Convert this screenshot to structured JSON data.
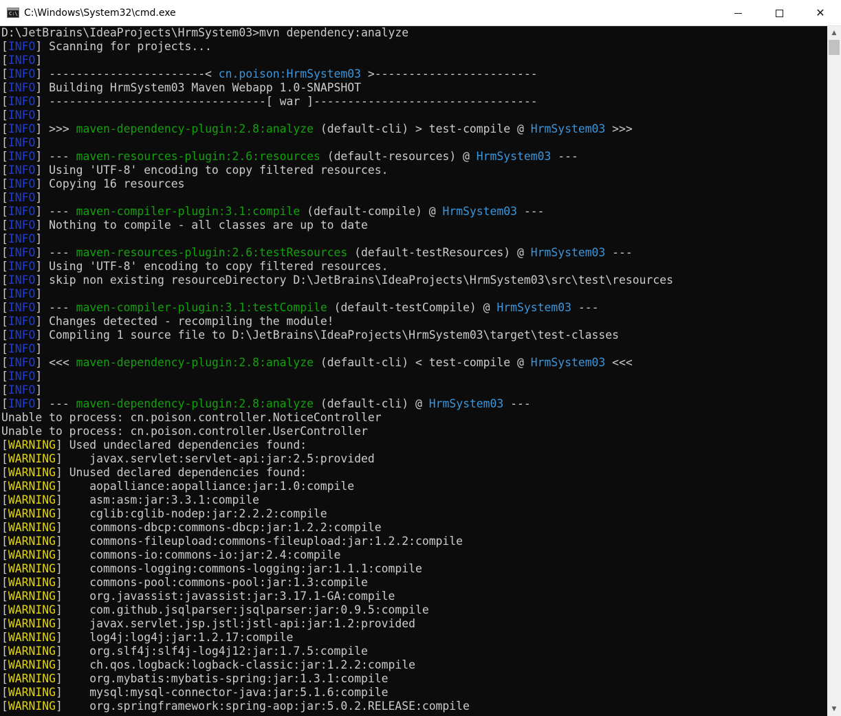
{
  "window": {
    "title": "C:\\Windows\\System32\\cmd.exe",
    "icon_text": "C:\\",
    "minimize_glyph": "",
    "maximize_glyph": "",
    "close_glyph": "✕"
  },
  "colors": {
    "info_tag": "#1f3bd8",
    "warning_tag": "#e5d500",
    "plugin": "#13a10e",
    "project": "#3a96dd",
    "text": "#cccccc",
    "background": "#0c0c0c"
  },
  "console": {
    "lines": [
      [
        {
          "t": "D:\\JetBrains\\IdeaProjects\\HrmSystem03>mvn dependency:analyze",
          "c": "text"
        }
      ],
      [
        {
          "t": "[",
          "c": "text"
        },
        {
          "t": "INFO",
          "c": "info"
        },
        {
          "t": "] Scanning for projects...",
          "c": "text"
        }
      ],
      [
        {
          "t": "[",
          "c": "text"
        },
        {
          "t": "INFO",
          "c": "info"
        },
        {
          "t": "]",
          "c": "text"
        }
      ],
      [
        {
          "t": "[",
          "c": "text"
        },
        {
          "t": "INFO",
          "c": "info"
        },
        {
          "t": "] -----------------------< ",
          "c": "text"
        },
        {
          "t": "cn.poison:HrmSystem03",
          "c": "cyan"
        },
        {
          "t": " >------------------------",
          "c": "text"
        }
      ],
      [
        {
          "t": "[",
          "c": "text"
        },
        {
          "t": "INFO",
          "c": "info"
        },
        {
          "t": "] Building HrmSystem03 Maven Webapp 1.0-SNAPSHOT",
          "c": "text"
        }
      ],
      [
        {
          "t": "[",
          "c": "text"
        },
        {
          "t": "INFO",
          "c": "info"
        },
        {
          "t": "] --------------------------------[ war ]---------------------------------",
          "c": "text"
        }
      ],
      [
        {
          "t": "[",
          "c": "text"
        },
        {
          "t": "INFO",
          "c": "info"
        },
        {
          "t": "]",
          "c": "text"
        }
      ],
      [
        {
          "t": "[",
          "c": "text"
        },
        {
          "t": "INFO",
          "c": "info"
        },
        {
          "t": "] >>> ",
          "c": "text"
        },
        {
          "t": "maven-dependency-plugin:2.8:analyze",
          "c": "green"
        },
        {
          "t": " (default-cli) > test-compile @ ",
          "c": "text"
        },
        {
          "t": "HrmSystem03",
          "c": "cyan"
        },
        {
          "t": " >>>",
          "c": "text"
        }
      ],
      [
        {
          "t": "[",
          "c": "text"
        },
        {
          "t": "INFO",
          "c": "info"
        },
        {
          "t": "]",
          "c": "text"
        }
      ],
      [
        {
          "t": "[",
          "c": "text"
        },
        {
          "t": "INFO",
          "c": "info"
        },
        {
          "t": "] --- ",
          "c": "text"
        },
        {
          "t": "maven-resources-plugin:2.6:resources",
          "c": "green"
        },
        {
          "t": " (default-resources) @ ",
          "c": "text"
        },
        {
          "t": "HrmSystem03",
          "c": "cyan"
        },
        {
          "t": " ---",
          "c": "text"
        }
      ],
      [
        {
          "t": "[",
          "c": "text"
        },
        {
          "t": "INFO",
          "c": "info"
        },
        {
          "t": "] Using 'UTF-8' encoding to copy filtered resources.",
          "c": "text"
        }
      ],
      [
        {
          "t": "[",
          "c": "text"
        },
        {
          "t": "INFO",
          "c": "info"
        },
        {
          "t": "] Copying 16 resources",
          "c": "text"
        }
      ],
      [
        {
          "t": "[",
          "c": "text"
        },
        {
          "t": "INFO",
          "c": "info"
        },
        {
          "t": "]",
          "c": "text"
        }
      ],
      [
        {
          "t": "[",
          "c": "text"
        },
        {
          "t": "INFO",
          "c": "info"
        },
        {
          "t": "] --- ",
          "c": "text"
        },
        {
          "t": "maven-compiler-plugin:3.1:compile",
          "c": "green"
        },
        {
          "t": " (default-compile) @ ",
          "c": "text"
        },
        {
          "t": "HrmSystem03",
          "c": "cyan"
        },
        {
          "t": " ---",
          "c": "text"
        }
      ],
      [
        {
          "t": "[",
          "c": "text"
        },
        {
          "t": "INFO",
          "c": "info"
        },
        {
          "t": "] Nothing to compile - all classes are up to date",
          "c": "text"
        }
      ],
      [
        {
          "t": "[",
          "c": "text"
        },
        {
          "t": "INFO",
          "c": "info"
        },
        {
          "t": "]",
          "c": "text"
        }
      ],
      [
        {
          "t": "[",
          "c": "text"
        },
        {
          "t": "INFO",
          "c": "info"
        },
        {
          "t": "] --- ",
          "c": "text"
        },
        {
          "t": "maven-resources-plugin:2.6:testResources",
          "c": "green"
        },
        {
          "t": " (default-testResources) @ ",
          "c": "text"
        },
        {
          "t": "HrmSystem03",
          "c": "cyan"
        },
        {
          "t": " ---",
          "c": "text"
        }
      ],
      [
        {
          "t": "[",
          "c": "text"
        },
        {
          "t": "INFO",
          "c": "info"
        },
        {
          "t": "] Using 'UTF-8' encoding to copy filtered resources.",
          "c": "text"
        }
      ],
      [
        {
          "t": "[",
          "c": "text"
        },
        {
          "t": "INFO",
          "c": "info"
        },
        {
          "t": "] skip non existing resourceDirectory D:\\JetBrains\\IdeaProjects\\HrmSystem03\\src\\test\\resources",
          "c": "text"
        }
      ],
      [
        {
          "t": "[",
          "c": "text"
        },
        {
          "t": "INFO",
          "c": "info"
        },
        {
          "t": "]",
          "c": "text"
        }
      ],
      [
        {
          "t": "[",
          "c": "text"
        },
        {
          "t": "INFO",
          "c": "info"
        },
        {
          "t": "] --- ",
          "c": "text"
        },
        {
          "t": "maven-compiler-plugin:3.1:testCompile",
          "c": "green"
        },
        {
          "t": " (default-testCompile) @ ",
          "c": "text"
        },
        {
          "t": "HrmSystem03",
          "c": "cyan"
        },
        {
          "t": " ---",
          "c": "text"
        }
      ],
      [
        {
          "t": "[",
          "c": "text"
        },
        {
          "t": "INFO",
          "c": "info"
        },
        {
          "t": "] Changes detected - recompiling the module!",
          "c": "text"
        }
      ],
      [
        {
          "t": "[",
          "c": "text"
        },
        {
          "t": "INFO",
          "c": "info"
        },
        {
          "t": "] Compiling 1 source file to D:\\JetBrains\\IdeaProjects\\HrmSystem03\\target\\test-classes",
          "c": "text"
        }
      ],
      [
        {
          "t": "[",
          "c": "text"
        },
        {
          "t": "INFO",
          "c": "info"
        },
        {
          "t": "]",
          "c": "text"
        }
      ],
      [
        {
          "t": "[",
          "c": "text"
        },
        {
          "t": "INFO",
          "c": "info"
        },
        {
          "t": "] <<< ",
          "c": "text"
        },
        {
          "t": "maven-dependency-plugin:2.8:analyze",
          "c": "green"
        },
        {
          "t": " (default-cli) < test-compile @ ",
          "c": "text"
        },
        {
          "t": "HrmSystem03",
          "c": "cyan"
        },
        {
          "t": " <<<",
          "c": "text"
        }
      ],
      [
        {
          "t": "[",
          "c": "text"
        },
        {
          "t": "INFO",
          "c": "info"
        },
        {
          "t": "]",
          "c": "text"
        }
      ],
      [
        {
          "t": "[",
          "c": "text"
        },
        {
          "t": "INFO",
          "c": "info"
        },
        {
          "t": "]",
          "c": "text"
        }
      ],
      [
        {
          "t": "[",
          "c": "text"
        },
        {
          "t": "INFO",
          "c": "info"
        },
        {
          "t": "] --- ",
          "c": "text"
        },
        {
          "t": "maven-dependency-plugin:2.8:analyze",
          "c": "green"
        },
        {
          "t": " (default-cli) @ ",
          "c": "text"
        },
        {
          "t": "HrmSystem03",
          "c": "cyan"
        },
        {
          "t": " ---",
          "c": "text"
        }
      ],
      [
        {
          "t": "Unable to process: cn.poison.controller.NoticeController",
          "c": "text"
        }
      ],
      [
        {
          "t": "Unable to process: cn.poison.controller.UserController",
          "c": "text"
        }
      ],
      [
        {
          "t": "[",
          "c": "text"
        },
        {
          "t": "WARNING",
          "c": "warning"
        },
        {
          "t": "] Used undeclared dependencies found:",
          "c": "text"
        }
      ],
      [
        {
          "t": "[",
          "c": "text"
        },
        {
          "t": "WARNING",
          "c": "warning"
        },
        {
          "t": "]    javax.servlet:servlet-api:jar:2.5:provided",
          "c": "text"
        }
      ],
      [
        {
          "t": "[",
          "c": "text"
        },
        {
          "t": "WARNING",
          "c": "warning"
        },
        {
          "t": "] Unused declared dependencies found:",
          "c": "text"
        }
      ],
      [
        {
          "t": "[",
          "c": "text"
        },
        {
          "t": "WARNING",
          "c": "warning"
        },
        {
          "t": "]    aopalliance:aopalliance:jar:1.0:compile",
          "c": "text"
        }
      ],
      [
        {
          "t": "[",
          "c": "text"
        },
        {
          "t": "WARNING",
          "c": "warning"
        },
        {
          "t": "]    asm:asm:jar:3.3.1:compile",
          "c": "text"
        }
      ],
      [
        {
          "t": "[",
          "c": "text"
        },
        {
          "t": "WARNING",
          "c": "warning"
        },
        {
          "t": "]    cglib:cglib-nodep:jar:2.2.2:compile",
          "c": "text"
        }
      ],
      [
        {
          "t": "[",
          "c": "text"
        },
        {
          "t": "WARNING",
          "c": "warning"
        },
        {
          "t": "]    commons-dbcp:commons-dbcp:jar:1.2.2:compile",
          "c": "text"
        }
      ],
      [
        {
          "t": "[",
          "c": "text"
        },
        {
          "t": "WARNING",
          "c": "warning"
        },
        {
          "t": "]    commons-fileupload:commons-fileupload:jar:1.2.2:compile",
          "c": "text"
        }
      ],
      [
        {
          "t": "[",
          "c": "text"
        },
        {
          "t": "WARNING",
          "c": "warning"
        },
        {
          "t": "]    commons-io:commons-io:jar:2.4:compile",
          "c": "text"
        }
      ],
      [
        {
          "t": "[",
          "c": "text"
        },
        {
          "t": "WARNING",
          "c": "warning"
        },
        {
          "t": "]    commons-logging:commons-logging:jar:1.1.1:compile",
          "c": "text"
        }
      ],
      [
        {
          "t": "[",
          "c": "text"
        },
        {
          "t": "WARNING",
          "c": "warning"
        },
        {
          "t": "]    commons-pool:commons-pool:jar:1.3:compile",
          "c": "text"
        }
      ],
      [
        {
          "t": "[",
          "c": "text"
        },
        {
          "t": "WARNING",
          "c": "warning"
        },
        {
          "t": "]    org.javassist:javassist:jar:3.17.1-GA:compile",
          "c": "text"
        }
      ],
      [
        {
          "t": "[",
          "c": "text"
        },
        {
          "t": "WARNING",
          "c": "warning"
        },
        {
          "t": "]    com.github.jsqlparser:jsqlparser:jar:0.9.5:compile",
          "c": "text"
        }
      ],
      [
        {
          "t": "[",
          "c": "text"
        },
        {
          "t": "WARNING",
          "c": "warning"
        },
        {
          "t": "]    javax.servlet.jsp.jstl:jstl-api:jar:1.2:provided",
          "c": "text"
        }
      ],
      [
        {
          "t": "[",
          "c": "text"
        },
        {
          "t": "WARNING",
          "c": "warning"
        },
        {
          "t": "]    log4j:log4j:jar:1.2.17:compile",
          "c": "text"
        }
      ],
      [
        {
          "t": "[",
          "c": "text"
        },
        {
          "t": "WARNING",
          "c": "warning"
        },
        {
          "t": "]    org.slf4j:slf4j-log4j12:jar:1.7.5:compile",
          "c": "text"
        }
      ],
      [
        {
          "t": "[",
          "c": "text"
        },
        {
          "t": "WARNING",
          "c": "warning"
        },
        {
          "t": "]    ch.qos.logback:logback-classic:jar:1.2.2:compile",
          "c": "text"
        }
      ],
      [
        {
          "t": "[",
          "c": "text"
        },
        {
          "t": "WARNING",
          "c": "warning"
        },
        {
          "t": "]    org.mybatis:mybatis-spring:jar:1.3.1:compile",
          "c": "text"
        }
      ],
      [
        {
          "t": "[",
          "c": "text"
        },
        {
          "t": "WARNING",
          "c": "warning"
        },
        {
          "t": "]    mysql:mysql-connector-java:jar:5.1.6:compile",
          "c": "text"
        }
      ],
      [
        {
          "t": "[",
          "c": "text"
        },
        {
          "t": "WARNING",
          "c": "warning"
        },
        {
          "t": "]    org.springframework:spring-aop:jar:5.0.2.RELEASE:compile",
          "c": "text"
        }
      ]
    ]
  },
  "scrollbar": {
    "up_arrow": "▲",
    "down_arrow": "▼",
    "position": 0.0
  }
}
